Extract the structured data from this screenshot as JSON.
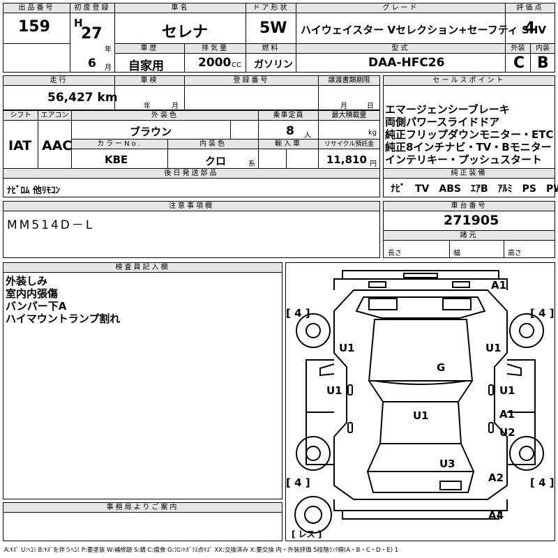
{
  "header": {
    "lot_label": "出品番号",
    "lot": "159",
    "reg_label": "初度登録",
    "era": "H",
    "year": "27",
    "year_unit": "年",
    "month": "6",
    "month_unit": "月",
    "name_label": "車名",
    "name": "セレナ",
    "door_label": "ドア形状",
    "door": "5W",
    "grade_label": "グレード",
    "grade": "ハイウェイスター Vセレクション+セーフティ SHV",
    "score_label": "評価点",
    "score": "4",
    "history_label": "車歴",
    "history": "自家用",
    "disp_label": "排気量",
    "disp": "2000",
    "disp_unit": "CC",
    "fuel_label": "燃料",
    "fuel": "ガソリン",
    "model_label": "型式",
    "model": "DAA-HFC26",
    "ext_label": "外装",
    "ext": "C",
    "int_label": "内装",
    "int": "B"
  },
  "row2": {
    "mileage_label": "走行",
    "mileage": "56,427 km",
    "inspection_label": "車検",
    "insp_year": "年",
    "insp_month": "月",
    "regno_label": "登録番号",
    "transfer_label": "譲渡書類期限",
    "tr_month": "月",
    "tr_day": "日"
  },
  "sales": {
    "label": "セールスポイント",
    "lines": [
      "エマージェンシーブレーキ",
      "両側パワースライドドア",
      "純正フリップダウンモニター・ETC",
      "純正8インチナビ・TV・Bモニター",
      "インテリキー・プッシュスタート"
    ],
    "equip_label": "純正装備",
    "equip": "ﾅﾋﾞ　TV　ABS　ｴｱB　ｱﾙﾐ　PS　PW"
  },
  "specs": {
    "shift_label": "シフト",
    "shift": "IAT",
    "ac_label": "エアコン",
    "ac": "AAC",
    "color_label": "外装色",
    "color": "ブラウン",
    "capacity_label": "乗車定員",
    "capacity": "8",
    "capacity_unit": "人",
    "load_label": "最大積載量",
    "load_unit": "kg",
    "color_no_label": "カラーNo.",
    "color_no": "KBE",
    "interior_label": "内装色",
    "interior": "クロ",
    "interior_unit": "系",
    "import_label": "輸入車",
    "recycle_label": "リサイクル預託金",
    "recycle": "11,810",
    "recycle_unit": "円",
    "later_label": "後日発送部品",
    "later": "ﾅﾋﾞﾛﾑ 他ﾘﾓｺﾝ"
  },
  "notes": {
    "label": "注意事項欄",
    "text": "MM514D－L"
  },
  "chassis": {
    "label": "車台番号",
    "value": "271905",
    "dims_label": "諸元",
    "len": "長さ",
    "width": "幅",
    "height": "高さ"
  },
  "inspector": {
    "label": "検査員記入欄",
    "lines": [
      "外装しみ",
      "室内内張傷",
      "バンパー下A",
      "ハイマウントランプ割れ"
    ]
  },
  "office": {
    "label": "事務局よりご案内"
  },
  "diagram": {
    "marks": {
      "fb": "A1",
      "fl": "U1",
      "fr": "U1",
      "hood": "G",
      "ml": "U1",
      "mr": "U1",
      "roof": "U1",
      "ra1": "A1",
      "ru2": "U2",
      "back": "U3",
      "rq": "A2",
      "rb": "A4"
    },
    "tires": {
      "fl": "4",
      "fr": "4",
      "rl": "4",
      "rr": "4"
    },
    "spare": "レス"
  },
  "legend": "A:ｷｽﾞ U:ﾍｺﾐ B:ｷｽﾞを伴うﾍｺﾐ P:要塗装 W:補修跡 S:錆 C:腐食 G:ﾌﾛﾝﾄｶﾞﾗｽ点ｷｽﾞ XX:交換済み X:要交換  内・外装評価 5段階ﾗﾝｸ順(A・B・C・D・E) 1"
}
